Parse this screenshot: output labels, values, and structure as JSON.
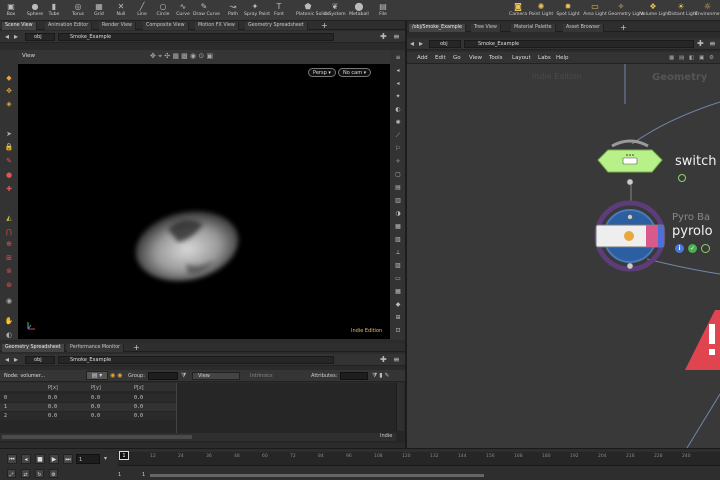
{
  "shelf": {
    "left_tools": [
      {
        "label": "Box",
        "icon": "box-icon",
        "glyph": "▣"
      },
      {
        "label": "Sphere",
        "icon": "sphere-icon",
        "glyph": "●"
      },
      {
        "label": "Tube",
        "icon": "tube-icon",
        "glyph": "▮"
      },
      {
        "label": "Torus",
        "icon": "torus-icon",
        "glyph": "◎"
      },
      {
        "label": "Grid",
        "icon": "grid-icon",
        "glyph": "▦"
      },
      {
        "label": "Null",
        "icon": "null-icon",
        "glyph": "✕"
      },
      {
        "label": "Line",
        "icon": "line-icon",
        "glyph": "╱"
      },
      {
        "label": "Circle",
        "icon": "circle-icon",
        "glyph": "○"
      },
      {
        "label": "Curve",
        "icon": "curve-icon",
        "glyph": "∿"
      },
      {
        "label": "Draw Curve",
        "icon": "draw-curve-icon",
        "glyph": "✎"
      },
      {
        "label": "Path",
        "icon": "path-icon",
        "glyph": "↝"
      },
      {
        "label": "Spray Paint",
        "icon": "spray-paint-icon",
        "glyph": "✦"
      },
      {
        "label": "Font",
        "icon": "font-icon",
        "glyph": "T"
      },
      {
        "label": "Platonic Solids",
        "icon": "platonic-solids-icon",
        "glyph": "⬟"
      },
      {
        "label": "L-System",
        "icon": "l-system-icon",
        "glyph": "❦"
      },
      {
        "label": "Metaball",
        "icon": "metaball-icon",
        "glyph": "⬤"
      },
      {
        "label": "File",
        "icon": "file-icon",
        "glyph": "▤"
      }
    ],
    "right_tools": [
      {
        "label": "Camera",
        "icon": "camera-icon",
        "glyph": "◙"
      },
      {
        "label": "Point Light",
        "icon": "point-light-icon",
        "glyph": "✺"
      },
      {
        "label": "Spot Light",
        "icon": "spot-light-icon",
        "glyph": "✹"
      },
      {
        "label": "Area Light",
        "icon": "area-light-icon",
        "glyph": "▭"
      },
      {
        "label": "Geometry Light",
        "icon": "geometry-light-icon",
        "glyph": "✧"
      },
      {
        "label": "Volume Light",
        "icon": "volume-light-icon",
        "glyph": "❖"
      },
      {
        "label": "Distant Light",
        "icon": "distant-light-icon",
        "glyph": "☀"
      },
      {
        "label": "Environment Light",
        "icon": "environment-light-icon",
        "glyph": "☼"
      }
    ]
  },
  "left_pane": {
    "tabs": [
      "Scene View",
      "Animation Editor",
      "Render View",
      "Composite View",
      "Motion FX View",
      "Geometry Spreadsheet"
    ],
    "path_root": "obj",
    "path_node": "Smoke_Example"
  },
  "viewport": {
    "title": "View",
    "perspective": "Persp ▾",
    "camera": "No cam ▾",
    "watermark": "Indie Edition"
  },
  "spreadsheet": {
    "tabs": [
      "Geometry Spreadsheet",
      "Performance Monitor"
    ],
    "path_root": "obj",
    "path_node": "Smoke_Example",
    "node_label": "Node: volumer...",
    "group_label": "Group:",
    "view_label": "View",
    "intrinsics_label": "Intrinsics",
    "attributes_label": "Attributes:",
    "columns": [
      "P[x]",
      "P[y]",
      "P[z]"
    ],
    "rows": [
      {
        "index": "0",
        "values": [
          "0.0",
          "0.0",
          "0.0"
        ]
      },
      {
        "index": "1",
        "values": [
          "0.0",
          "0.0",
          "0.0"
        ]
      },
      {
        "index": "2",
        "values": [
          "0.0",
          "0.0",
          "0.0"
        ]
      }
    ],
    "footer": "Indie"
  },
  "right_pane": {
    "tabs": [
      "/obj/Smoke_Example",
      "Tree View",
      "Material Palette",
      "Asset Browser"
    ],
    "path_root": "obj",
    "path_node": "Smoke_Example",
    "menu": [
      "Add",
      "Edit",
      "Go",
      "View",
      "Tools",
      "Layout",
      "Labs",
      "Help"
    ]
  },
  "network": {
    "edition_watermark": "Indie Edition",
    "context_label": "Geometry",
    "switch_node": "switch",
    "pyro_node_type": "Pyro Ba",
    "pyro_node_name": "pyrolo"
  },
  "playbar": {
    "current_frame": "1",
    "start_frame": "1",
    "range_start": "1",
    "range_end": "1",
    "ticks": [
      "1",
      "12",
      "24",
      "36",
      "48",
      "60",
      "72",
      "84",
      "96",
      "108",
      "120",
      "132",
      "144",
      "156",
      "168",
      "180",
      "192",
      "204",
      "216",
      "228",
      "240"
    ]
  },
  "colors": {
    "switch_node": "#b8f08a",
    "pyro_ring": "#5c3d7a",
    "pyro_accent": "#d85a8a",
    "error_red": "#e0454f",
    "background": "#393939"
  }
}
